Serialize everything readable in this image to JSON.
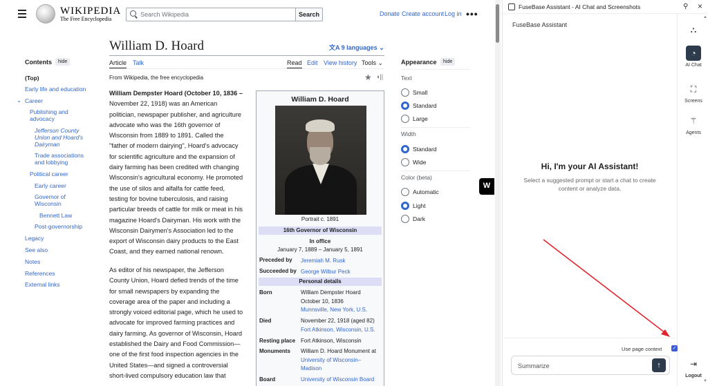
{
  "wiki": {
    "wordmark": "Wikipedia",
    "tagline": "The Free Encyclopedia",
    "search_placeholder": "Search Wikipedia",
    "search_button": "Search",
    "donate": "Donate",
    "create_account": "Create account",
    "login": "Log in",
    "more": "•••"
  },
  "toc": {
    "title": "Contents",
    "hide": "hide",
    "items": [
      "(Top)",
      "Early life and education",
      "Career",
      "Publishing and",
      "advocacy",
      "Jefferson County",
      "Union and Hoard's",
      "Dairyman",
      "Trade associations",
      "and lobbying",
      "Political career",
      "Early career",
      "Governor of",
      "Wisconsin",
      "Bennett Law",
      "Post-governorship",
      "Legacy",
      "See also",
      "Notes",
      "References",
      "External links"
    ]
  },
  "article": {
    "title": "William D. Hoard",
    "languages": "9 languages",
    "tab_article": "Article",
    "tab_talk": "Talk",
    "tab_read": "Read",
    "tab_edit": "Edit",
    "tab_history": "View history",
    "tab_tools": "Tools",
    "from": "From Wikipedia, the free encyclopedia",
    "p1": [
      "William Dempster Hoard (October 10, 1836 –",
      "November 22, 1918) was an American",
      "politician, newspaper publisher, and agriculture",
      "advocate who was the 16th governor of",
      "Wisconsin from 1889 to 1891. Called the",
      "\"father of modern dairying\", Hoard's advocacy",
      "for scientific agriculture and the expansion of",
      "dairy farming has been credited with changing",
      "Wisconsin's agricultural economy. He promoted",
      "the use of silos and alfalfa for cattle feed,",
      "testing for bovine tuberculosis, and raising",
      "particular breeds of cattle for milk or meat in his",
      "magazine Hoard's Dairyman. His work with the",
      "Wisconsin Dairymen's Association led to the",
      "export of Wisconsin dairy products to the East",
      "Coast, and they earned national renown."
    ],
    "p2": [
      "As editor of his newspaper, the Jefferson",
      "County Union, Hoard defied trends of the time",
      "for small newspapers by expanding the",
      "coverage area of the paper and including a",
      "strongly voiced editorial page, which he used to",
      "advocate for improved farming practices and",
      "dairy farming. As governor of Wisconsin, Hoard",
      "established the Dairy and Food Commission—",
      "one of the first food inspection agencies in the",
      "United States—and signed a controversial",
      "short-lived compulsory education law that"
    ]
  },
  "infobox": {
    "title": "William D. Hoard",
    "caption": "Portrait c. 1891",
    "office_band": "16th Governor of Wisconsin",
    "in_office": "In office",
    "term": "January 7, 1889 – January 5, 1891",
    "preceded_label": "Preceded by",
    "preceded": "Jeremiah M. Rusk",
    "succeeded_label": "Succeeded by",
    "succeeded": "George Wilbur Peck",
    "personal_band": "Personal details",
    "born_label": "Born",
    "born": [
      "William Dempster Hoard",
      "October 10, 1836",
      "Munnsville, New York, U.S."
    ],
    "died_label": "Died",
    "died": [
      "November 22, 1918 (aged 82)",
      "Fort Atkinson, Wisconsin, U.S."
    ],
    "resting_label": "Resting place",
    "resting": "Fort Atkinson, Wisconsin",
    "monuments_label": "Monuments",
    "monuments": [
      "William D. Hoard Monument at",
      "University of Wisconsin–",
      "Madison"
    ],
    "board_label": "Board",
    "board": "University of Wisconsin Board"
  },
  "appearance": {
    "title": "Appearance",
    "hide": "hide",
    "text_head": "Text",
    "small": "Small",
    "standard": "Standard",
    "large": "Large",
    "width_head": "Width",
    "width_standard": "Standard",
    "wide": "Wide",
    "color_head": "Color (beta)",
    "automatic": "Automatic",
    "light": "Light",
    "dark": "Dark"
  },
  "panel": {
    "title": "FuseBase Assistant - AI Chat and Screenshots",
    "subtitle": "FuseBase Assistant",
    "greeting": "Hi, I'm your AI Assistant!",
    "greeting_sub": "Select a suggested prompt or start a chat to create content or analyze data.",
    "use_context": "Use page context",
    "input_value": "Summarize",
    "rail": [
      "AI Chat",
      "Screens",
      "Agents",
      "Logout"
    ]
  },
  "colors": {
    "link": "#3366cc",
    "accent_dark": "#2d3b4c",
    "annotation_arrow": "#e0242f"
  }
}
